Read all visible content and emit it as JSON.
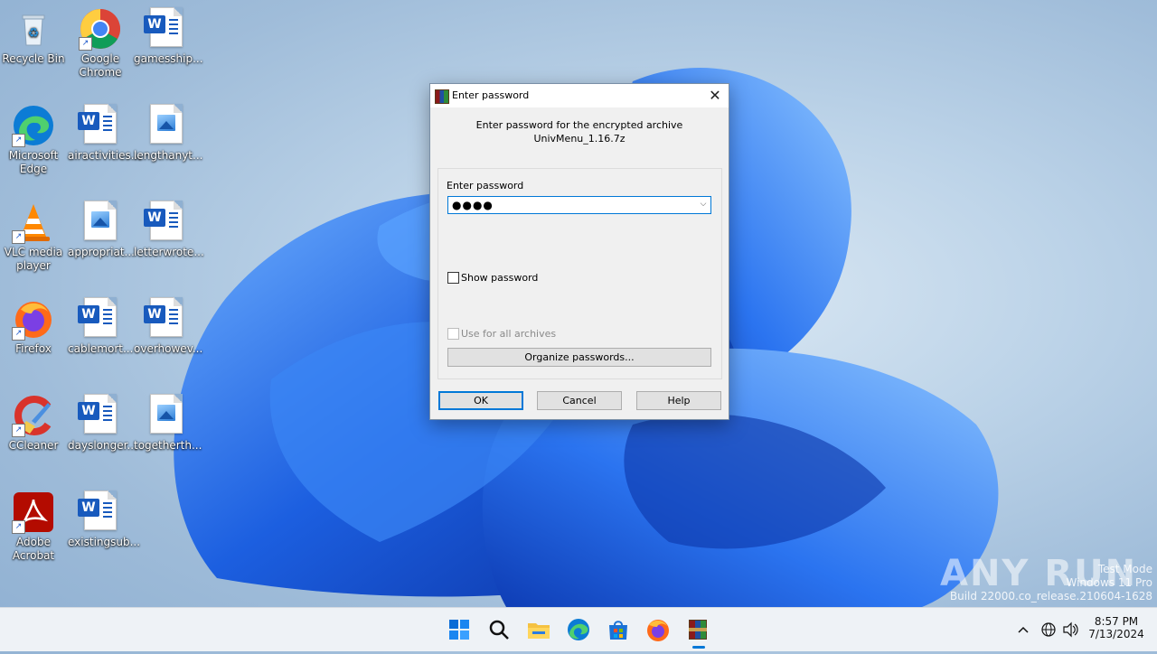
{
  "desktop": {
    "icons": [
      {
        "label": "Recycle Bin"
      },
      {
        "label": "Google Chrome"
      },
      {
        "label": "gamesship..."
      },
      {
        "label": "Microsoft Edge"
      },
      {
        "label": "airactivities..."
      },
      {
        "label": "lengthanyt..."
      },
      {
        "label": "VLC media player"
      },
      {
        "label": "appropriat..."
      },
      {
        "label": "letterwrote..."
      },
      {
        "label": "Firefox"
      },
      {
        "label": "cablemort..."
      },
      {
        "label": "overhowev..."
      },
      {
        "label": "CCleaner"
      },
      {
        "label": "dayslonger..."
      },
      {
        "label": "togetherth..."
      },
      {
        "label": "Adobe Acrobat"
      },
      {
        "label": "existingsub..."
      }
    ]
  },
  "dialog": {
    "title": "Enter password",
    "prompt_line1": "Enter password for the encrypted archive",
    "archive_name": "UnivMenu_1.16.7z",
    "password_label": "Enter password",
    "password_value": "●●●●",
    "show_password_label": "Show password",
    "use_for_all_label": "Use for all archives",
    "organize_label": "Organize passwords...",
    "ok_label": "OK",
    "cancel_label": "Cancel",
    "help_label": "Help"
  },
  "watermark": {
    "line1": "Test Mode",
    "line2": "Windows 11 Pro",
    "line3": "Build 22000.co_release.210604-1628",
    "brand": "ANY RUN"
  },
  "taskbar": {
    "time": "8:57 PM",
    "date": "7/13/2024"
  },
  "colors": {
    "accent": "#0078d7",
    "wallpaper_blue": "#1f63d8"
  }
}
